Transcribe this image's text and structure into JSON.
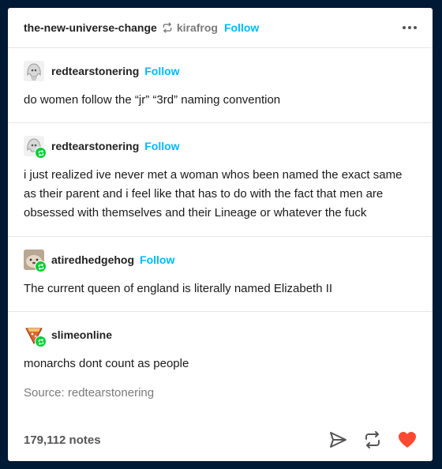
{
  "header": {
    "blog_name": "the-new-universe-change",
    "reblog_icon": "reblog-icon",
    "reblogged_from": "kirafrog",
    "follow_label": "Follow",
    "menu_icon": "ellipsis-icon"
  },
  "posts": [
    {
      "author": "redtearstonering",
      "follow_label": "Follow",
      "text": "do women follow the “jr” “3rd” naming convention"
    },
    {
      "author": "redtearstonering",
      "follow_label": "Follow",
      "text": "i just realized ive never met a woman whos been named the exact same as their parent and i feel like that has to do with the fact that men are obsessed with themselves and their Lineage or whatever the fuck"
    },
    {
      "author": "atiredhedgehog",
      "follow_label": "Follow",
      "text": "The current queen of england is literally named Elizabeth II"
    },
    {
      "author": "slimeonline",
      "text": "monarchs dont count as people"
    }
  ],
  "source": "Source: redtearstonering",
  "footer": {
    "notes": "179,112 notes",
    "icons": [
      "share-icon",
      "reblog-icon",
      "like-heart-icon"
    ]
  },
  "colors": {
    "background": "#001935",
    "accent_link": "#00b8ff",
    "reblog_badge": "#00cf35",
    "like": "#ff4930"
  }
}
